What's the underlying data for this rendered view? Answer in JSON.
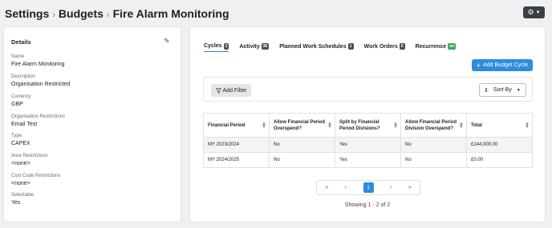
{
  "breadcrumb": {
    "items": [
      "Settings",
      "Budgets",
      "Fire Alarm Monitoring"
    ]
  },
  "details": {
    "heading": "Details",
    "fields": [
      {
        "label": "Name",
        "value": "Fire Alarm Monitoring"
      },
      {
        "label": "Description",
        "value": "Organisation Restricted"
      },
      {
        "label": "Currency",
        "value": "GBP"
      },
      {
        "label": "Organisation Restrictions",
        "value": "Email Test"
      },
      {
        "label": "Type",
        "value": "CAPEX"
      },
      {
        "label": "Area Restrictions",
        "value": "<none>"
      },
      {
        "label": "Cost Code Restrictions",
        "value": "<none>"
      },
      {
        "label": "Selectable",
        "value": "Yes"
      }
    ]
  },
  "tabs": [
    {
      "label": "Cycles",
      "count": "2"
    },
    {
      "label": "Activity",
      "count": "36"
    },
    {
      "label": "Planned Work Schedules",
      "count": "1"
    },
    {
      "label": "Work Orders",
      "count": "0"
    },
    {
      "label": "Recurrence",
      "count": "on"
    }
  ],
  "toolbar": {
    "add_cycle_label": "Add Budget Cycle",
    "add_filter_label": "Add Filter",
    "sort_label": "Sort By"
  },
  "table": {
    "headers": [
      [
        "Financial Period"
      ],
      [
        "Allow Financial Period",
        "Overspend?"
      ],
      [
        "Split by Financial",
        "Period Divisions?"
      ],
      [
        "Allow Financial Period",
        "Division Overspend?"
      ],
      [
        "Total"
      ]
    ],
    "rows": [
      [
        "MY 2023/2024",
        "No",
        "Yes",
        "No",
        "£144,000.00"
      ],
      [
        "MY 2024/2025",
        "No",
        "Yes",
        "No",
        "£0.00"
      ]
    ]
  },
  "pagination": {
    "first": "«",
    "prev": "‹",
    "current": "1",
    "next": "›",
    "last": "»",
    "summary": "Showing 1 - 2 of 2"
  },
  "colors": {
    "accent": "#2d8ddc",
    "recurrence_badge": "#3aa95a"
  }
}
